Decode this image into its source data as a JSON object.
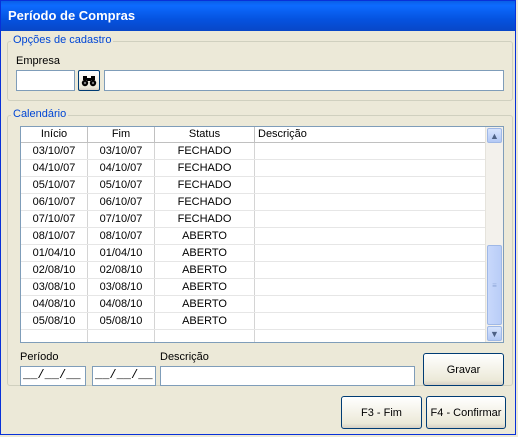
{
  "window": {
    "title": "Período de Compras"
  },
  "cadastro": {
    "legend": "Opções de cadastro",
    "empresa_label": "Empresa",
    "empresa_code": "",
    "empresa_name": ""
  },
  "calendario": {
    "legend": "Calendário",
    "columns": [
      "Início",
      "Fim",
      "Status",
      "Descrição"
    ],
    "rows": [
      {
        "inicio": "03/10/07",
        "fim": "03/10/07",
        "status": "FECHADO",
        "descricao": ""
      },
      {
        "inicio": "04/10/07",
        "fim": "04/10/07",
        "status": "FECHADO",
        "descricao": ""
      },
      {
        "inicio": "05/10/07",
        "fim": "05/10/07",
        "status": "FECHADO",
        "descricao": ""
      },
      {
        "inicio": "06/10/07",
        "fim": "06/10/07",
        "status": "FECHADO",
        "descricao": ""
      },
      {
        "inicio": "07/10/07",
        "fim": "07/10/07",
        "status": "FECHADO",
        "descricao": ""
      },
      {
        "inicio": "08/10/07",
        "fim": "08/10/07",
        "status": "ABERTO",
        "descricao": ""
      },
      {
        "inicio": "01/04/10",
        "fim": "01/04/10",
        "status": "ABERTO",
        "descricao": ""
      },
      {
        "inicio": "02/08/10",
        "fim": "02/08/10",
        "status": "ABERTO",
        "descricao": ""
      },
      {
        "inicio": "03/08/10",
        "fim": "03/08/10",
        "status": "ABERTO",
        "descricao": ""
      },
      {
        "inicio": "04/08/10",
        "fim": "04/08/10",
        "status": "ABERTO",
        "descricao": ""
      },
      {
        "inicio": "05/08/10",
        "fim": "05/08/10",
        "status": "ABERTO",
        "descricao": ""
      }
    ]
  },
  "edit": {
    "periodo_label": "Período",
    "descricao_label": "Descrição",
    "periodo_inicio": "__/__/__",
    "periodo_fim": "__/__/__",
    "descricao_value": "",
    "gravar_label": "Gravar"
  },
  "footer": {
    "fim_label": "F3 - Fim",
    "confirmar_label": "F4 - Confirmar"
  }
}
